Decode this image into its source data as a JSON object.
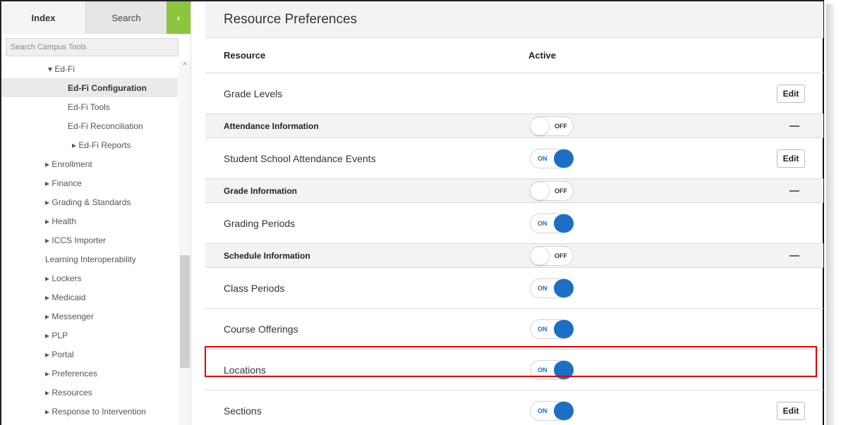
{
  "sidebar": {
    "tabs": {
      "index": "Index",
      "search": "Search",
      "collapse": "‹"
    },
    "search_placeholder": "Search Campus Tools",
    "items": [
      {
        "label": "▾ Ed-Fi",
        "level": 1
      },
      {
        "label": "Ed-Fi Configuration",
        "level": 2,
        "selected": true
      },
      {
        "label": "Ed-Fi Tools",
        "level": 2
      },
      {
        "label": "Ed-Fi Reconciliation",
        "level": 2
      },
      {
        "label": "▸ Ed-Fi Reports",
        "level": 3
      },
      {
        "label": "▸ Enrollment",
        "level": 0
      },
      {
        "label": "▸ Finance",
        "level": 0
      },
      {
        "label": "▸ Grading & Standards",
        "level": 0
      },
      {
        "label": "▸ Health",
        "level": 0
      },
      {
        "label": "▸ ICCS Importer",
        "level": 0
      },
      {
        "label": "Learning Interoperability",
        "level": 0
      },
      {
        "label": "▸ Lockers",
        "level": 0
      },
      {
        "label": "▸ Medicaid",
        "level": 0
      },
      {
        "label": "▸ Messenger",
        "level": 0
      },
      {
        "label": "▸ PLP",
        "level": 0
      },
      {
        "label": "▸ Portal",
        "level": 0
      },
      {
        "label": "▸ Preferences",
        "level": 0
      },
      {
        "label": "▸ Resources",
        "level": 0
      },
      {
        "label": "▸ Response to Intervention",
        "level": 0
      }
    ],
    "scroll_up_icon": "chevron-up-icon"
  },
  "main": {
    "title": "Resource Preferences",
    "columns": {
      "resource": "Resource",
      "active": "Active"
    },
    "edit_label": "Edit",
    "toggle_on": "ON",
    "toggle_off": "OFF",
    "rows": [
      {
        "type": "item",
        "name": "Grade Levels",
        "toggle": null,
        "edit": true
      },
      {
        "type": "group",
        "name": "Attendance Information",
        "toggle": "off",
        "collapse": true
      },
      {
        "type": "item",
        "name": "Student School Attendance Events",
        "toggle": "on",
        "edit": true
      },
      {
        "type": "group",
        "name": "Grade Information",
        "toggle": "off",
        "collapse": true
      },
      {
        "type": "item",
        "name": "Grading Periods",
        "toggle": "on",
        "edit": false
      },
      {
        "type": "group",
        "name": "Schedule Information",
        "toggle": "off",
        "collapse": true
      },
      {
        "type": "item",
        "name": "Class Periods",
        "toggle": "on",
        "edit": false
      },
      {
        "type": "item",
        "name": "Course Offerings",
        "toggle": "on",
        "edit": false
      },
      {
        "type": "item",
        "name": "Locations",
        "toggle": "on",
        "edit": false,
        "highlighted": true
      },
      {
        "type": "item",
        "name": "Sections",
        "toggle": "on",
        "edit": true
      }
    ]
  },
  "colors": {
    "accent_green": "#8cc63f",
    "toggle_blue": "#1b6fc4",
    "highlight_red": "#e00000"
  }
}
